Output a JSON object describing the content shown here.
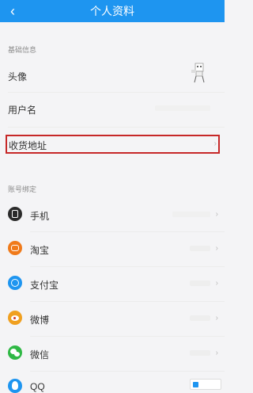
{
  "header": {
    "title": "个人资料",
    "back_icon": "chevron-left-icon"
  },
  "basic": {
    "section_label": "基础信息",
    "avatar_label": "头像",
    "username_label": "用户名",
    "address_label": "收货地址"
  },
  "accounts": {
    "section_label": "账号绑定",
    "items": [
      {
        "label": "手机",
        "icon": "phone-icon",
        "color": "#2b2b2b"
      },
      {
        "label": "淘宝",
        "icon": "taobao-icon",
        "color": "#f07a1a"
      },
      {
        "label": "支付宝",
        "icon": "alipay-icon",
        "color": "#1e95f0"
      },
      {
        "label": "微博",
        "icon": "weibo-icon",
        "color": "#f0a020"
      },
      {
        "label": "微信",
        "icon": "wechat-icon",
        "color": "#2fb845"
      },
      {
        "label": "QQ",
        "icon": "qq-icon",
        "color": "#1e95f0"
      }
    ]
  },
  "colors": {
    "header": "#1e95f0",
    "highlight": "#c62828"
  }
}
